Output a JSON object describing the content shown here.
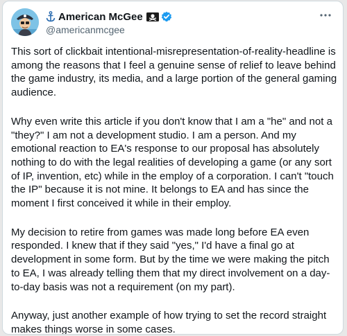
{
  "author": {
    "display_name": "American McGee",
    "handle": "@americanmcgee",
    "verified": true,
    "name_emoji_left": "anchor-icon",
    "name_emoji_right": "pirate-flag-icon"
  },
  "more_menu_label": "···",
  "tweet": {
    "paragraphs": [
      "This sort of clickbait intentional-misrepresentation-of-reality-headline is among the reasons that I feel a genuine sense of relief to leave behind the game industry, its media, and a large portion of the general gaming audience.",
      "Why even write this article if you don't know that I am a \"he\" and not a \"they?\" I am not a development studio. I am a person. And my emotional reaction to EA's response to our proposal has absolutely nothing to do with the legal realities of developing a game (or any sort of IP, invention, etc) while in the employ of a corporation. I can't \"touch the IP\" because it is not mine. It belongs to EA and has since the moment I first conceived it while in their employ.",
      "My decision to retire from games was made long before EA even responded. I knew that if they said \"yes,\" I'd have a final go at development in some form. But by the time we were making the pitch to EA, I was already telling them that my direct involvement on a day-to-day basis was not a requirement (on my part).",
      "Anyway, just another example of how trying to set the record straight makes things worse in some cases."
    ]
  },
  "colors": {
    "text": "#0f1419",
    "secondary": "#536471",
    "verified": "#1d9bf0",
    "border": "#cfd9de"
  }
}
